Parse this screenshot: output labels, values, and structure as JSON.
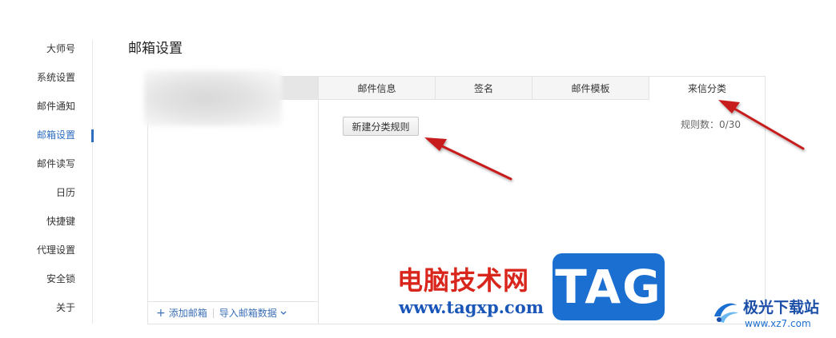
{
  "nav": {
    "items": [
      {
        "label": "大师号"
      },
      {
        "label": "系统设置"
      },
      {
        "label": "邮件通知"
      },
      {
        "label": "邮箱设置",
        "active": true
      },
      {
        "label": "邮件读写"
      },
      {
        "label": "日历"
      },
      {
        "label": "快捷键"
      },
      {
        "label": "代理设置"
      },
      {
        "label": "安全锁"
      },
      {
        "label": "关于"
      }
    ]
  },
  "page": {
    "title": "邮箱设置"
  },
  "accounts": {
    "add_label": "添加邮箱",
    "import_label": "导入邮箱数据"
  },
  "tabs": [
    {
      "label": "邮件信息"
    },
    {
      "label": "签名"
    },
    {
      "label": "邮件模板"
    },
    {
      "label": "来信分类",
      "active": true
    }
  ],
  "classify": {
    "new_rule_label": "新建分类规则",
    "rule_count": "规则数：0/30"
  },
  "watermark": {
    "site_name": "电脑技术网",
    "site_url": "www.tagxp.com",
    "tag_text": "TAG",
    "brand_name": "极光下载站",
    "brand_url": "www.xz7.com"
  },
  "colors": {
    "accent": "#2e6dc1",
    "arrow": "#c81e1e",
    "tag_bg": "#1b6fd0"
  }
}
